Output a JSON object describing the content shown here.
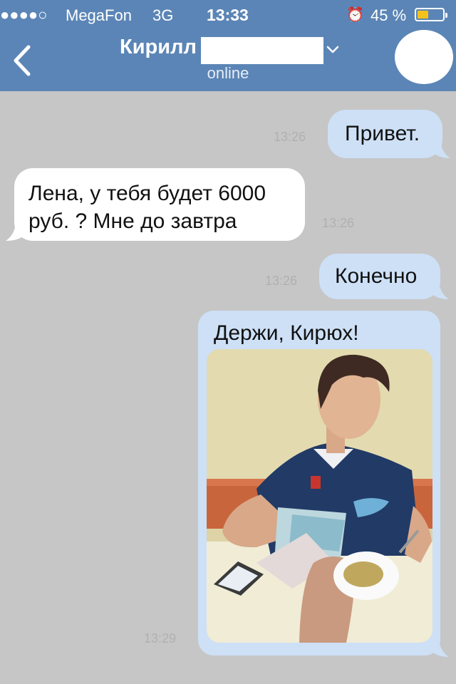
{
  "status_bar": {
    "signal": "●●●●○",
    "carrier": "MegaFon",
    "network": "3G",
    "time": "13:33",
    "battery_percent": "45 %",
    "battery_level": 0.45,
    "battery_color": "#f5c21b",
    "alarm_icon": "alarm-clock-icon"
  },
  "header": {
    "contact_name": "Кирилл",
    "subtitle": "online",
    "back_icon": "chevron-left-icon",
    "expand_icon": "chevron-down-icon",
    "color": "#5b85b6"
  },
  "messages": [
    {
      "direction": "outgoing",
      "text": "Привет.",
      "time": "13:26"
    },
    {
      "direction": "incoming",
      "text": "Лена, у тебя будет 6000 руб. ? Мне до завтра",
      "time": "13:26"
    },
    {
      "direction": "outgoing",
      "text": "Конечно",
      "time": "13:26"
    },
    {
      "direction": "outgoing",
      "text": "Держи, Кирюх!",
      "time": "13:29",
      "has_photo": true
    }
  ],
  "colors": {
    "chat_background": "#c6c6c6",
    "outgoing_bubble": "#cde0f6",
    "incoming_bubble": "#ffffff"
  }
}
